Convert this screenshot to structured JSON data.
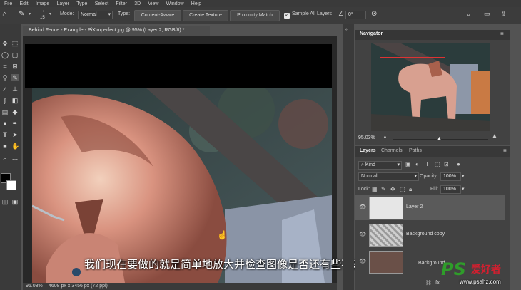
{
  "menubar": {
    "items": [
      "File",
      "Edit",
      "Image",
      "Layer",
      "Type",
      "Select",
      "Filter",
      "3D",
      "View",
      "Window",
      "Help"
    ]
  },
  "options": {
    "brush_size": "15",
    "mode_label": "Mode:",
    "mode_value": "Normal",
    "type_label": "Type:",
    "type_buttons": [
      "Content-Aware",
      "Create Texture",
      "Proximity Match"
    ],
    "sample_all_layers": "Sample All Layers",
    "angle": "0°"
  },
  "document": {
    "tab_title": "Behind Fence - Example - PiXimperfect.jpg @ 95% (Layer 2, RGB/8) *",
    "zoom": "95.03%",
    "dimensions": "4608 px x 3456 px (72 ppi)"
  },
  "subtitle": "我们现在要做的就是简单地放大并检查图像是否还有些不对劲的地方",
  "navigator": {
    "title": "Navigator",
    "zoom": "95.03%"
  },
  "layers_panel": {
    "tabs": [
      "Layers",
      "Channels",
      "Paths"
    ],
    "filter_kind": "Kind",
    "blend_mode": "Normal",
    "opacity_label": "Opacity:",
    "opacity_value": "100%",
    "lock_label": "Lock:",
    "fill_label": "Fill:",
    "fill_value": "100%",
    "layers": [
      "Layer 2",
      "Background copy",
      "Background"
    ]
  },
  "watermark": {
    "brand": "PS",
    "name": "爱好者",
    "url": "www.psahz.com"
  },
  "colors": {
    "ui_dark": "#3a3a3a",
    "panel": "#424242",
    "watermark_green": "#2f9c2a",
    "watermark_red": "#d11f2f"
  }
}
